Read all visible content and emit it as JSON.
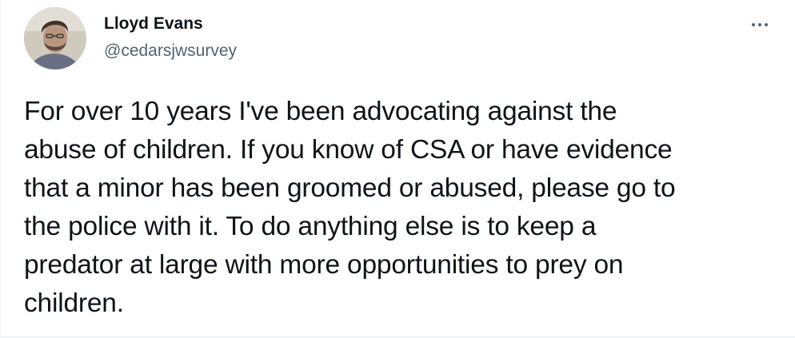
{
  "tweet": {
    "author": {
      "display_name": "Lloyd Evans",
      "handle": "@cedarsjwsurvey",
      "avatar_icon": "user-avatar-photo"
    },
    "more_icon": "more-horizontal-icon",
    "text": "For over 10 years I've been advocating against the\nabuse of children. If you know of CSA or have evidence\nthat a minor has been groomed or abused, please go to\nthe police with it. To do anything else is to keep a\npredator at large with more opportunities to prey on\nchildren."
  },
  "colors": {
    "text_primary": "#0f1419",
    "text_secondary": "#536471",
    "background": "#ffffff"
  }
}
